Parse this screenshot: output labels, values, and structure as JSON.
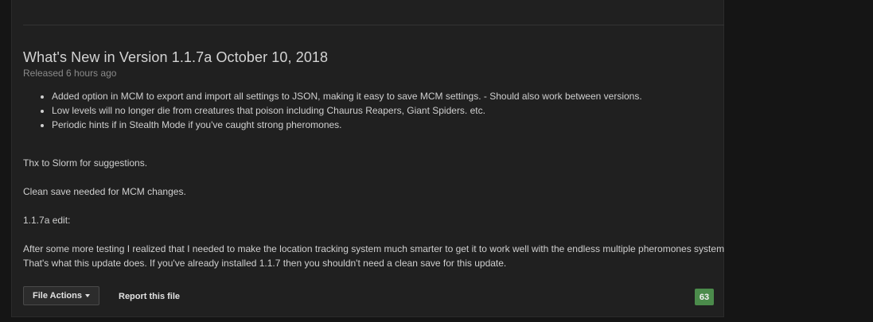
{
  "release": {
    "title": "What's New in Version 1.1.7a October 10, 2018",
    "released": "Released 6 hours ago",
    "changes": [
      "Added option in MCM to export and import all settings to JSON, making it easy to save MCM settings. - Should also work between versions.",
      "Low levels will no longer die from creatures that poison including Chaurus Reapers, Giant Spiders. etc.",
      "Periodic hints if in Stealth Mode if you've caught strong pheromones."
    ],
    "paragraphs": [
      "Thx to Slorm for suggestions.",
      "Clean save needed for MCM changes.",
      "1.1.7a edit:",
      "After some more testing I realized that I needed to make the location tracking system much smarter to get it to work well with the endless multiple pheromones system.",
      "That's what this update does. If you've already installed 1.1.7 then you shouldn't need a clean save for this update."
    ]
  },
  "footer": {
    "file_actions_label": "File Actions",
    "report_label": "Report this file",
    "count": "63"
  },
  "colors": {
    "badge": "#4b8b4b",
    "background": "#202020",
    "text": "#cfcfcf"
  }
}
